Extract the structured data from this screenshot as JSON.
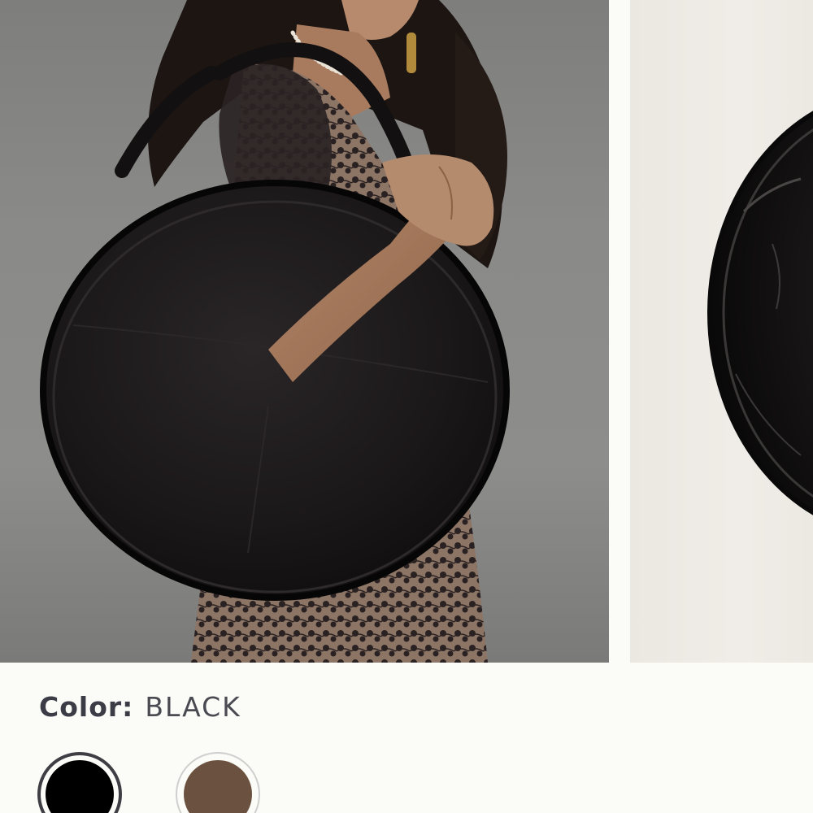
{
  "color_selector": {
    "label": "Color:",
    "selected_value": "BLACK",
    "options": [
      {
        "name": "black",
        "hex": "#000000",
        "selected": true
      },
      {
        "name": "brown",
        "hex": "#6b5240",
        "selected": false
      }
    ]
  },
  "images": [
    {
      "icon": "model-with-round-leather-bag-photo"
    },
    {
      "icon": "round-leather-bag-product-photo"
    }
  ],
  "colors": {
    "page_background": "#fbfbf7",
    "text": "#3c3c47",
    "selected_ring": "#3e3e44"
  }
}
